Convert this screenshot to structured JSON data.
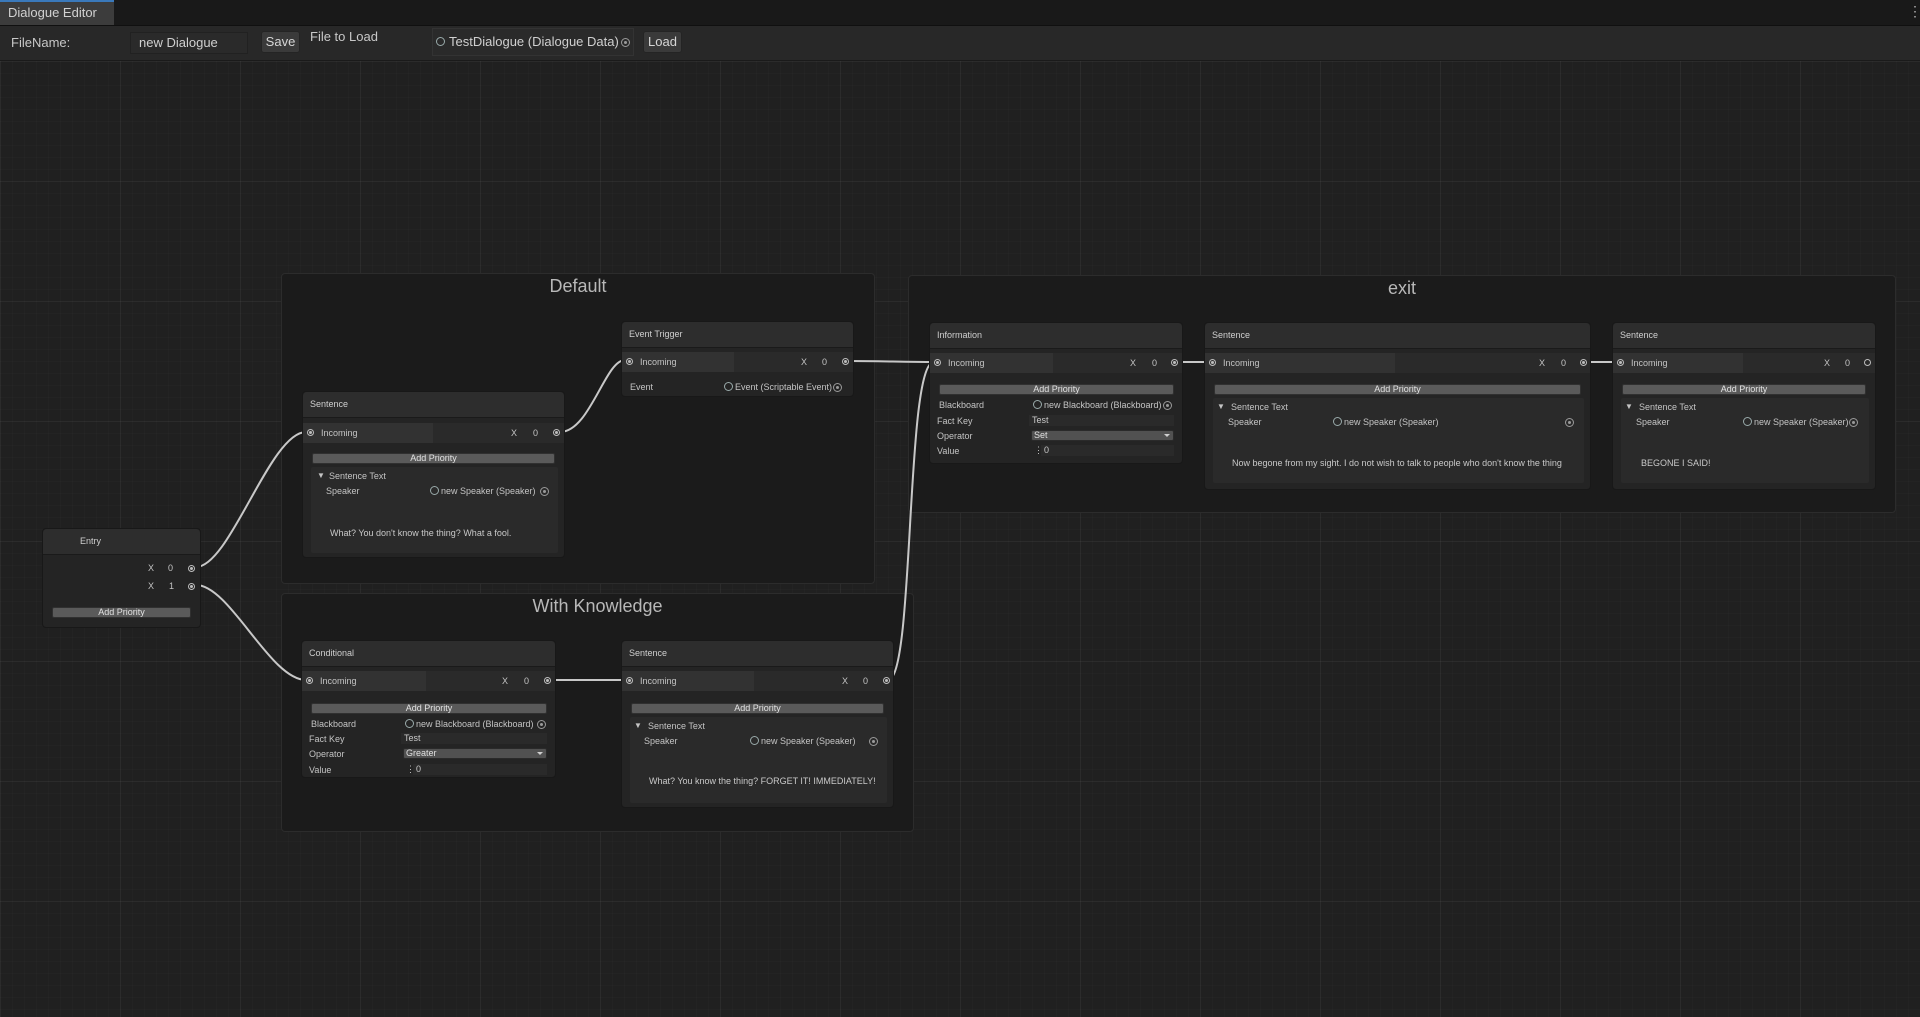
{
  "window": {
    "tab_title": "Dialogue Editor",
    "menu_icon": "kebab-menu-icon"
  },
  "toolbar": {
    "filename_label": "FileName:",
    "filename_value": "new Dialogue",
    "save_label": "Save",
    "file_to_load_label": "File to Load",
    "file_to_load_value": "TestDialogue (Dialogue Data)",
    "load_label": "Load"
  },
  "groups": {
    "default": "Default",
    "with_knowledge": "With Knowledge",
    "exit": "exit"
  },
  "common": {
    "incoming": "Incoming",
    "x": "X",
    "zero": "0",
    "one": "1",
    "add_priority": "Add Priority",
    "sentence_text": "Sentence Text",
    "speaker": "Speaker",
    "speaker_value": "new Speaker (Speaker)",
    "blackboard": "Blackboard",
    "blackboard_value": "new Blackboard (Blackboard)",
    "fact_key": "Fact Key",
    "operator": "Operator",
    "value": "Value"
  },
  "nodes": {
    "entry": {
      "title": "Entry"
    },
    "default_sentence": {
      "title": "Sentence",
      "text": "What? You don't know the thing? What a fool."
    },
    "event_trigger": {
      "title": "Event Trigger",
      "event_label": "Event",
      "event_value": "Event (Scriptable Event)"
    },
    "conditional": {
      "title": "Conditional",
      "fact_key_value": "Test",
      "operator_value": "Greater",
      "value_value": "0"
    },
    "knowledge_sentence": {
      "title": "Sentence",
      "text": "What? You know the thing? FORGET IT! IMMEDIATELY!"
    },
    "information": {
      "title": "Information",
      "fact_key_value": "Test",
      "operator_value": "Set",
      "value_value": "0"
    },
    "exit_sentence_1": {
      "title": "Sentence",
      "text": "Now begone from my sight. I do not wish to talk to people who don't know the thing"
    },
    "exit_sentence_2": {
      "title": "Sentence",
      "text": "BEGONE I SAID!"
    }
  },
  "colors": {
    "background": "#202020",
    "panel": "#242424",
    "wire": "#c8c8c8",
    "tab_accent": "#3a79bb"
  }
}
